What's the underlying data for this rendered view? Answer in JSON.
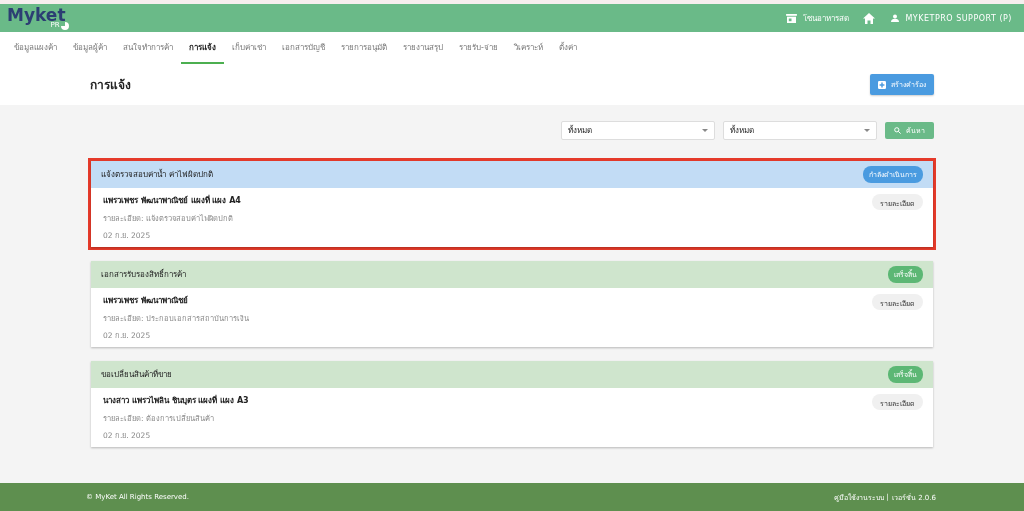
{
  "header": {
    "logo": "Myket",
    "logo_sub": "PR",
    "store": "โซนอาหารสด",
    "user": "MYKETPRO SUPPORT (P)"
  },
  "nav": [
    {
      "label": "ข้อมูลแผงค้า",
      "selected": false
    },
    {
      "label": "ข้อมูลผู้ค้า",
      "selected": false
    },
    {
      "label": "สนใจทำการค้า",
      "selected": false
    },
    {
      "label": "การแจ้ง",
      "selected": true
    },
    {
      "label": "เก็บค่าเช่า",
      "selected": false
    },
    {
      "label": "เอกสารบัญชี",
      "selected": false
    },
    {
      "label": "รายการอนุมัติ",
      "selected": false
    },
    {
      "label": "รายงานสรุป",
      "selected": false
    },
    {
      "label": "รายรับ-จ่าย",
      "selected": false
    },
    {
      "label": "วิเคราะห์",
      "selected": false
    },
    {
      "label": "ตั้งค่า",
      "selected": false
    }
  ],
  "page_title": "การแจ้ง",
  "create_button": "สร้างคำร้อง",
  "filters": [
    {
      "value": "ทั้งหมด"
    },
    {
      "value": "ทั้งหมด"
    }
  ],
  "search_button": "ค้นหา",
  "notices": [
    {
      "title": "แจ้งตรวจสอบค่าน้ำ ค่าไฟผิดปกติ",
      "kind": "progress",
      "status_label": "กำลังดำเนินการ",
      "highlighted": true,
      "name": "แพรวเพชร พัฒนาพาณิชย์ แผงที่ แผง A4",
      "detail": "รายละเอียด: แจ้งตรวจสอบค่าไฟผิดปกติ",
      "date": "02 ก.ย. 2025",
      "button": "รายละเอียด"
    },
    {
      "title": "เอกสารรับรองสิทธิ์การค้า",
      "kind": "done",
      "status_label": "เสร็จสิ้น",
      "highlighted": false,
      "name": "แพรวเพชร พัฒนาพาณิชย์",
      "detail": "รายละเอียด: ประกอบเอกสารสถาบันการเงิน",
      "date": "02 ก.ย. 2025",
      "button": "รายละเอียด"
    },
    {
      "title": "ขอเปลี่ยนสินค้าที่ขาย",
      "kind": "done",
      "status_label": "เสร็จสิ้น",
      "highlighted": false,
      "name": "นางสาว แพรวไพลิน ชินบุตร แผงที่ แผง A3",
      "detail": "รายละเอียด: ต้องการเปลี่ยนสินค้า",
      "date": "02 ก.ย. 2025",
      "button": "รายละเอียด"
    }
  ],
  "footer": {
    "copyright": "© MyKet All Rights Reserved.",
    "manual_link": "คู่มือใช้งานระบบ",
    "separator": "|",
    "version": "เวอร์ชั่น 2.0.6"
  }
}
